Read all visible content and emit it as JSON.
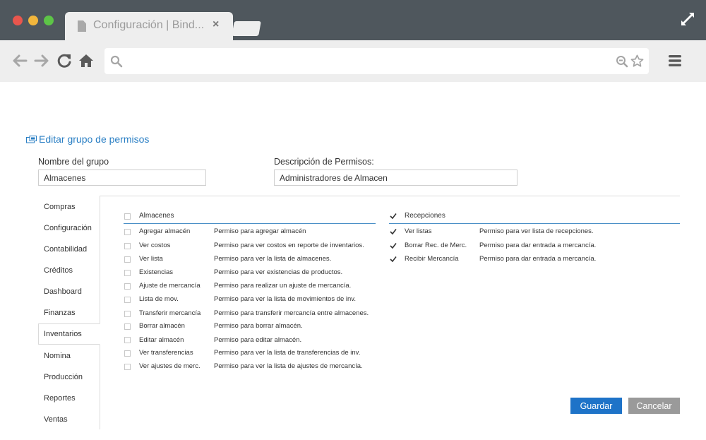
{
  "browser": {
    "tab_title": "Configuración | Bind...",
    "tab_close": "×",
    "icons": [
      "doc-icon",
      "expand-icon",
      "back-icon",
      "forward-icon",
      "reload-icon",
      "home-icon",
      "search-icon",
      "zoom-out-icon",
      "star-icon",
      "menu-icon"
    ]
  },
  "page": {
    "heading": "Editar grupo de permisos",
    "group_name_label": "Nombre del grupo",
    "group_name_value": "Almacenes",
    "description_label": "Descripción de Permisos:",
    "description_value": "Administradores de Almacen"
  },
  "sidebar": {
    "active": "Inventarios",
    "items": [
      {
        "label": "Compras"
      },
      {
        "label": "Configuración"
      },
      {
        "label": "Contabilidad"
      },
      {
        "label": "Créditos"
      },
      {
        "label": "Dashboard"
      },
      {
        "label": "Finanzas"
      },
      {
        "label": "Inventarios"
      },
      {
        "label": "Nomina"
      },
      {
        "label": "Producción"
      },
      {
        "label": "Reportes"
      },
      {
        "label": "Ventas"
      }
    ]
  },
  "sections": [
    {
      "title": "Almacenes",
      "checked": false,
      "permissions": [
        {
          "name": "Agregar almacén",
          "description": "Permiso para agregar almacén",
          "checked": false
        },
        {
          "name": "Ver costos",
          "description": "Permiso para ver costos en reporte de inventarios.",
          "checked": false
        },
        {
          "name": "Ver lista",
          "description": "Permiso para ver la lista de almacenes.",
          "checked": false
        },
        {
          "name": "Existencias",
          "description": "Permiso para ver existencias de productos.",
          "checked": false
        },
        {
          "name": "Ajuste de mercancía",
          "description": "Permiso para realizar un ajuste de mercancía.",
          "checked": false
        },
        {
          "name": "Lista de mov.",
          "description": "Permiso para ver la lista de movimientos de inv.",
          "checked": false
        },
        {
          "name": "Transferir mercancía",
          "description": "Permiso para transferir mercancía entre almacenes.",
          "checked": false
        },
        {
          "name": "Borrar almacén",
          "description": "Permiso para borrar almacén.",
          "checked": false
        },
        {
          "name": "Editar almacén",
          "description": "Permiso para editar almacén.",
          "checked": false
        },
        {
          "name": "Ver transferencias",
          "description": "Permiso para ver la lista de transferencias de inv.",
          "checked": false
        },
        {
          "name": "Ver ajustes de merc.",
          "description": "Permiso para ver la lista de ajustes de mercancía.",
          "checked": false
        }
      ]
    },
    {
      "title": "Recepciones",
      "checked": true,
      "permissions": [
        {
          "name": "Ver listas",
          "description": "Permiso para ver lista de recepciones.",
          "checked": true
        },
        {
          "name": "Borrar Rec. de Merc.",
          "description": "Permiso para dar entrada a mercancía.",
          "checked": true
        },
        {
          "name": "Recibir Mercancía",
          "description": "Permiso para dar entrada a mercancía.",
          "checked": true
        }
      ]
    }
  ],
  "buttons": {
    "save": "Guardar",
    "cancel": "Cancelar"
  },
  "colors": {
    "accent": "#1e73c8",
    "heading": "#2a7fc4",
    "cancel": "#9a9a9a",
    "chrome": "#4f575d"
  }
}
